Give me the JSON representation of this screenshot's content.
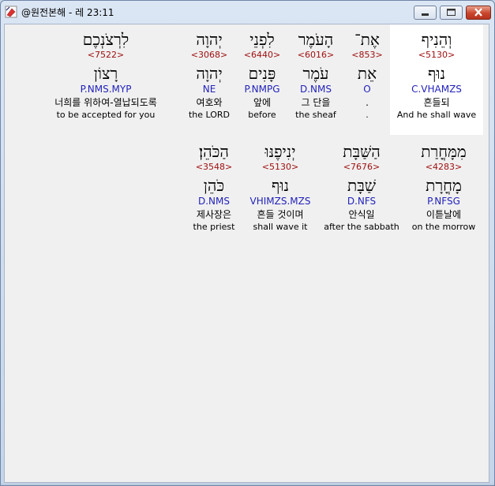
{
  "window": {
    "title": "@원전본해 - 레 23:11",
    "icons": {
      "app": "bible-app-icon",
      "minimize": "minimize-icon",
      "maximize": "maximize-icon",
      "close": "close-icon"
    }
  },
  "row1": [
    {
      "hebrew": "וְהֵנִיף",
      "strong": "<5130>",
      "lemma": "נוּף",
      "morph": "C.VHAMZS",
      "korean": "흔들되",
      "english": "And he shall wave",
      "selected": true
    },
    {
      "hebrew": "אֶת־",
      "strong": "<853>",
      "lemma": "אֵת",
      "morph": "O",
      "korean": ".",
      "english": "."
    },
    {
      "hebrew": "הָעֹמֶר",
      "strong": "<6016>",
      "lemma": "עֹמֶר",
      "morph": "D.NMS",
      "korean": "그 단을",
      "english": "the sheaf"
    },
    {
      "hebrew": "לִפְנֵי",
      "strong": "<6440>",
      "lemma": "פָּנִים",
      "morph": "P.NMPG",
      "korean": "앞에",
      "english": "before"
    },
    {
      "hebrew": "יְהוָה",
      "strong": "<3068>",
      "lemma": "יְהוָה",
      "morph": "NE",
      "korean": "여호와",
      "english": "the LORD"
    },
    {
      "hebrew": "לִרְצֹנְכֶם",
      "strong": "<7522>",
      "lemma": "רָצוֹן",
      "morph": "P.NMS.MYP",
      "korean": "너희를 위하여-열납되도록",
      "english": "to be accepted for you"
    }
  ],
  "row2": [
    {
      "hebrew": "מִמָּחֳרַת",
      "strong": "<4283>",
      "lemma": "מָחֳרָת",
      "morph": "P.NFSG",
      "korean": "이튿날에",
      "english": "on the morrow"
    },
    {
      "hebrew": "הַשַּׁבָּת",
      "strong": "<7676>",
      "lemma": "שַׁבָּת",
      "morph": "D.NFS",
      "korean": "안식일",
      "english": "after the sabbath"
    },
    {
      "hebrew": "יְנִיפֶנּוּ",
      "strong": "<5130>",
      "lemma": "נוּף",
      "morph": "VHIMZS.MZS",
      "korean": "흔들 것이며",
      "english": "shall wave it"
    },
    {
      "hebrew": "הַכֹּהֵן׃",
      "strong": "<3548>",
      "lemma": "כֹּהֵן",
      "morph": "D.NMS",
      "korean": "제사장은",
      "english": "the priest"
    }
  ]
}
